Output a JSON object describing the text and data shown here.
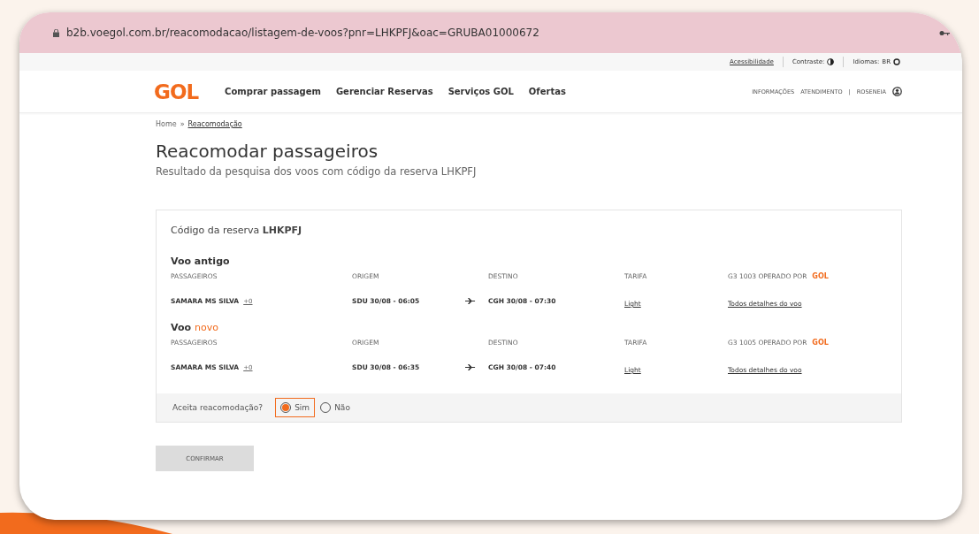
{
  "address_bar": {
    "url": "b2b.voegol.com.br/reacomodacao/listagem-de-voos?pnr=LHKPFJ&oac=GRUBA01000672"
  },
  "utility_bar": {
    "accessibility": "Acessibilidade",
    "contrast": "Contraste:",
    "language_label": "Idiomas:",
    "language": "BR"
  },
  "header": {
    "logo": "GOL",
    "nav": [
      "Comprar passagem",
      "Gerenciar Reservas",
      "Serviços GOL",
      "Ofertas"
    ],
    "info": "INFORMAÇÕES",
    "support": "ATENDIMENTO",
    "separator": "|",
    "user": "ROSENEIA"
  },
  "breadcrumb": [
    {
      "label": "Home",
      "link": false
    },
    {
      "label": "Reacomodação",
      "link": true
    }
  ],
  "breadcrumb_separator": "»",
  "title": "Reacomodar passageiros",
  "subtitle": "Resultado da pesquisa dos voos com código da reserva LHKPFJ",
  "reservation": {
    "label": "Código da reserva",
    "code": "LHKPFJ",
    "flights": [
      {
        "title": "Voo antigo",
        "columns": [
          "PASSAGEIROS",
          "ORIGEM",
          "DESTINO",
          "TARIFA",
          "G3 1003 OPERADO POR"
        ],
        "operator_logo": "GOL",
        "passenger": "SAMARA MS SILVA",
        "extra": "+0",
        "origin": "SDU 30/08 - 06:05",
        "destination": "CGH 30/08 - 07:30",
        "fare": "Light",
        "details": "Todos detalhes do voo"
      },
      {
        "title": "Voo",
        "accent": "novo",
        "columns": [
          "PASSAGEIROS",
          "ORIGEM",
          "DESTINO",
          "TARIFA",
          "G3 1005 OPERADO POR"
        ],
        "operator_logo": "GOL",
        "passenger": "SAMARA MS SILVA",
        "extra": "+0",
        "origin": "SDU 30/08 - 06:35",
        "destination": "CGH 30/08 - 07:40",
        "fare": "Light",
        "details": "Todos detalhes do voo"
      }
    ],
    "question": "Aceita reacomodação?",
    "options": [
      {
        "label": "Sim",
        "selected": true
      },
      {
        "label": "Não",
        "selected": false
      }
    ]
  },
  "confirm_button": {
    "label": "CONFIRMAR",
    "disabled": true
  }
}
